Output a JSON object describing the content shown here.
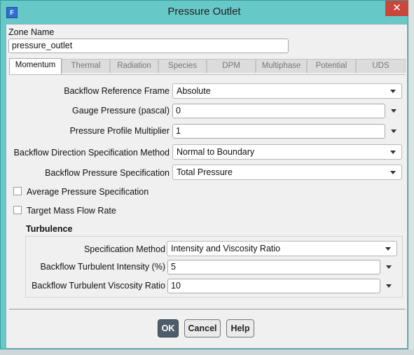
{
  "window": {
    "title": "Pressure Outlet",
    "app_icon_glyph": "F",
    "close_glyph": "✕"
  },
  "zone": {
    "label": "Zone Name",
    "value": "pressure_outlet"
  },
  "tabs": [
    {
      "label": "Momentum",
      "active": true
    },
    {
      "label": "Thermal",
      "active": false
    },
    {
      "label": "Radiation",
      "active": false
    },
    {
      "label": "Species",
      "active": false
    },
    {
      "label": "DPM",
      "active": false
    },
    {
      "label": "Multiphase",
      "active": false
    },
    {
      "label": "Potential",
      "active": false
    },
    {
      "label": "UDS",
      "active": false
    }
  ],
  "momentum": {
    "backflow_reference_frame": {
      "label": "Backflow Reference Frame",
      "value": "Absolute"
    },
    "gauge_pressure": {
      "label": "Gauge Pressure (pascal)",
      "value": "0"
    },
    "pressure_profile_multiplier": {
      "label": "Pressure Profile Multiplier",
      "value": "1"
    },
    "backflow_direction_method": {
      "label": "Backflow Direction Specification Method",
      "value": "Normal to Boundary"
    },
    "backflow_pressure_spec": {
      "label": "Backflow Pressure Specification",
      "value": "Total Pressure"
    },
    "average_pressure_spec": {
      "label": "Average Pressure Specification",
      "checked": false
    },
    "target_mass_flow_rate": {
      "label": "Target Mass Flow Rate",
      "checked": false
    }
  },
  "turbulence": {
    "title": "Turbulence",
    "specification_method": {
      "label": "Specification Method",
      "value": "Intensity and Viscosity Ratio"
    },
    "intensity": {
      "label": "Backflow Turbulent Intensity (%)",
      "value": "5"
    },
    "viscosity_ratio": {
      "label": "Backflow Turbulent Viscosity Ratio",
      "value": "10"
    }
  },
  "buttons": {
    "ok": "OK",
    "cancel": "Cancel",
    "help": "Help"
  },
  "colors": {
    "frame": "#67c8c8",
    "close_button": "#c9463d",
    "ok_button": "#4f5d6a"
  }
}
